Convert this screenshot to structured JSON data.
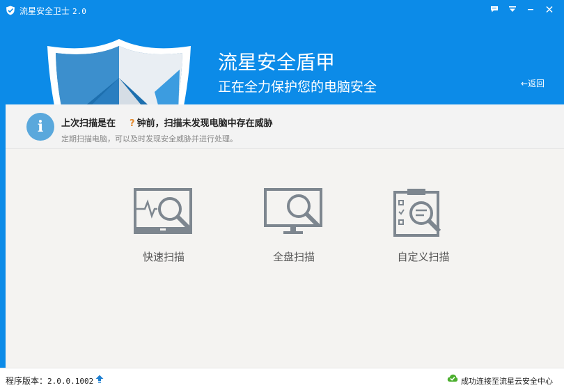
{
  "window": {
    "title": "流星安全卫士",
    "version": "2.0"
  },
  "titlebar_buttons": {
    "feedback_icon": "chat-bubble-icon",
    "menu_icon": "dropdown-menu-icon",
    "minimize_icon": "minimize-icon",
    "close_icon": "close-icon"
  },
  "banner": {
    "title": "流星安全盾甲",
    "subtitle": "正在全力保护您的电脑安全",
    "back_label": "←返回"
  },
  "info": {
    "line1_prefix": "上次扫描是在",
    "line1_unknown": "?",
    "line1_suffix": "钟前，扫描未发现电脑中存在威胁",
    "line2": "定期扫描电脑，可以及时发现安全威胁并进行处理。"
  },
  "scans": {
    "quick": "快速扫描",
    "full": "全盘扫描",
    "custom": "自定义扫描"
  },
  "status": {
    "version_label": "程序版本：",
    "version_value": "2.0.0.1002",
    "connection": "成功连接至流星云安全中心"
  },
  "colors": {
    "brand_blue": "#0c8be8",
    "icon_gray": "#7d868f",
    "info_blue": "#5aa8dc",
    "question_orange": "#e3892c",
    "ok_green": "#4caf2f"
  }
}
